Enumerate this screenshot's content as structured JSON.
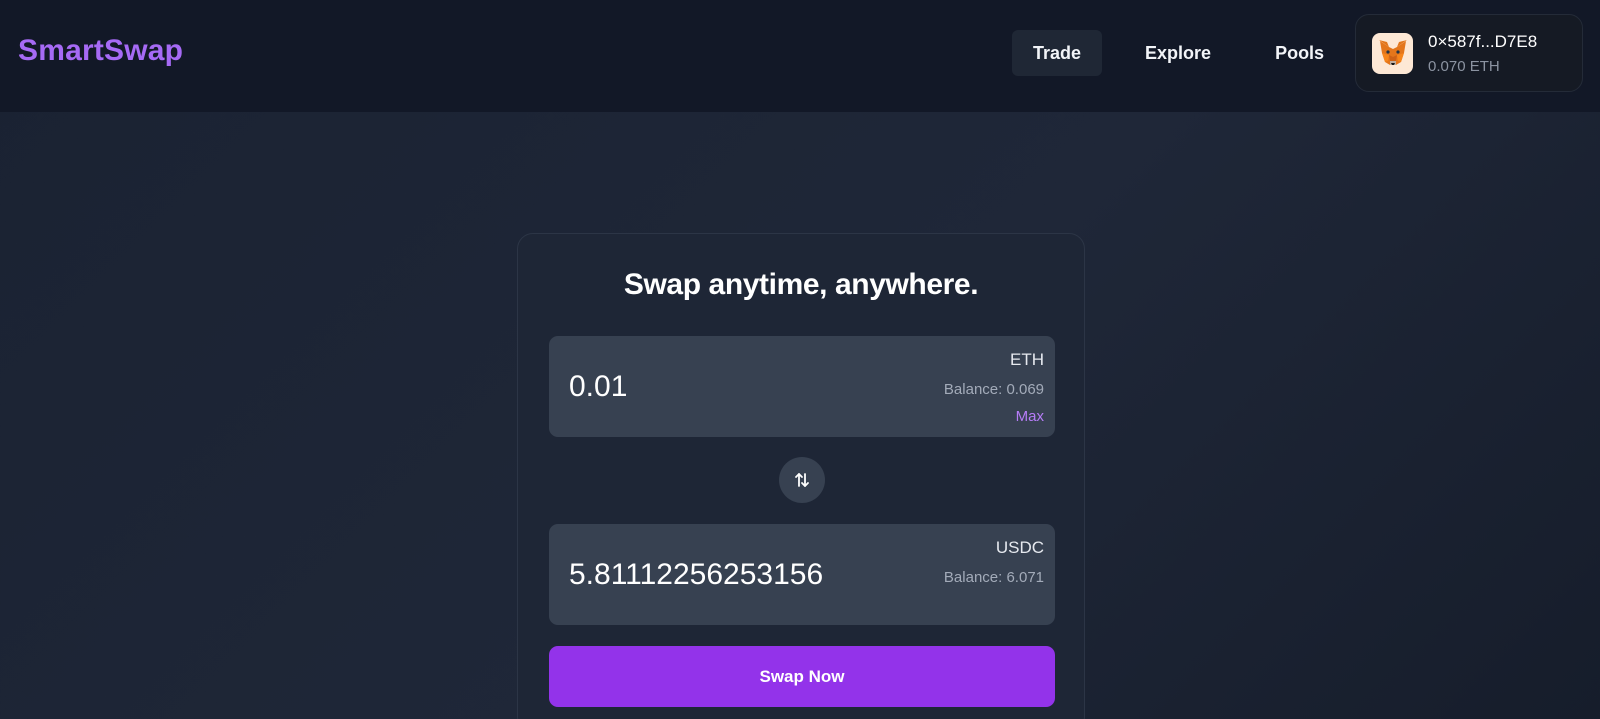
{
  "header": {
    "logo": "SmartSwap",
    "nav": [
      {
        "label": "Trade",
        "active": true
      },
      {
        "label": "Explore",
        "active": false
      },
      {
        "label": "Pools",
        "active": false
      }
    ],
    "wallet": {
      "icon": "metamask-fox-icon",
      "address": "0×587f...D7E8",
      "balance": "0.070 ETH"
    }
  },
  "swap": {
    "title": "Swap anytime, anywhere.",
    "from": {
      "amount": "0.01",
      "symbol": "ETH",
      "balance": "Balance: 0.069",
      "max_label": "Max"
    },
    "toggle_icon": "swap-arrows-icon",
    "to": {
      "amount": "5.81112256253156",
      "symbol": "USDC",
      "balance": "Balance: 6.071"
    },
    "button_label": "Swap Now"
  },
  "colors": {
    "accent": "#9333ea",
    "logo": "#a66af5",
    "max_link": "#b57cf7"
  }
}
